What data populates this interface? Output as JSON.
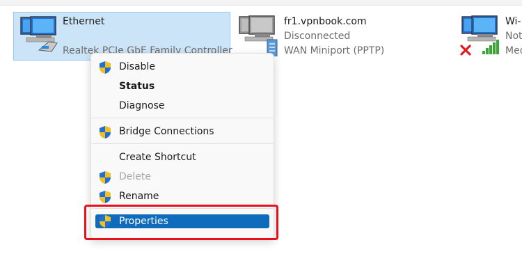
{
  "adapters": [
    {
      "name": "Ethernet",
      "line2": "",
      "line3": "Realtek PCIe GbE Family Controller"
    },
    {
      "name": "fr1.vpnbook.com",
      "line2": "Disconnected",
      "line3": "WAN Miniport (PPTP)"
    },
    {
      "name": "Wi-",
      "line2": "Not",
      "line3": "Med"
    }
  ],
  "menu": {
    "items": [
      {
        "label": "Disable",
        "shield": true
      },
      {
        "label": "Status",
        "shield": false,
        "bold": true
      },
      {
        "label": "Diagnose",
        "shield": false
      },
      {
        "label": "Bridge Connections",
        "shield": true
      },
      {
        "label": "Create Shortcut",
        "shield": false
      },
      {
        "label": "Delete",
        "shield": true,
        "disabled": true
      },
      {
        "label": "Rename",
        "shield": true
      },
      {
        "label": "Properties",
        "shield": true,
        "highlighted": true
      }
    ]
  },
  "icons": {
    "network_adapter": "network-adapter-icon",
    "uac_shield": "uac-shield-icon",
    "error_x": "red-x-icon",
    "signal": "signal-bars-icon"
  },
  "colors": {
    "selection_bg": "#cce4f7",
    "highlight": "#0f6cbd",
    "annotation_red": "#e8101a"
  }
}
